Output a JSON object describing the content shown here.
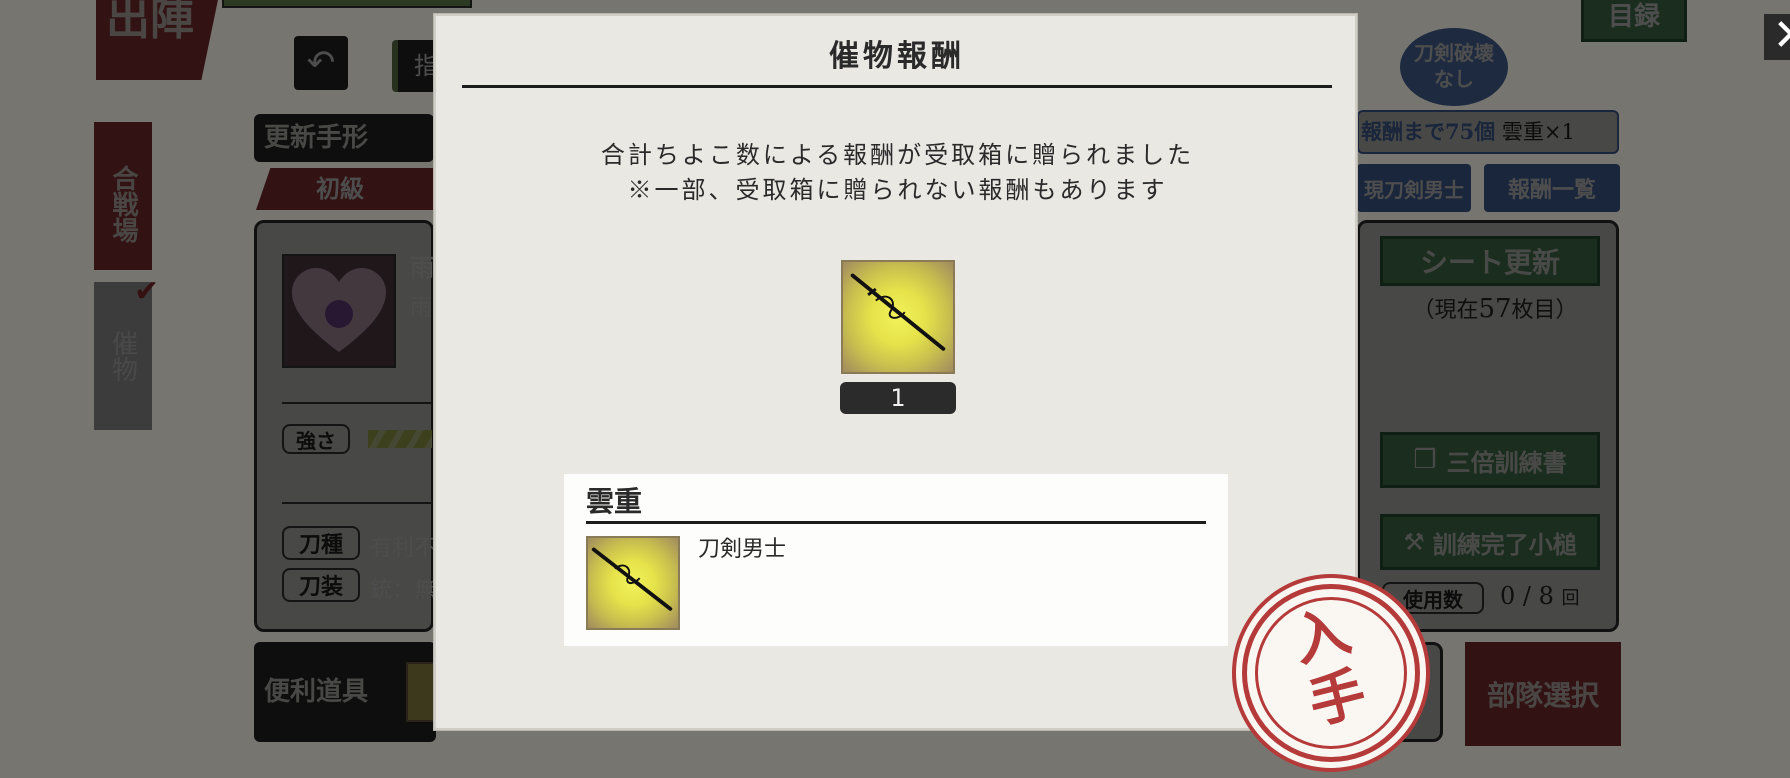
{
  "background": {
    "top_left_banner": "出陣",
    "sidebar_tab_active": "合戦場",
    "sidebar_tab_inactive": "催物",
    "bar_label": "更新手形",
    "level_tab": "初級",
    "partial_tab": "指",
    "char_name_partial": "雨",
    "char_sub_partial": "雨",
    "strength_label": "強さ",
    "blade_type_label": "刀種",
    "blade_type_value": "有利不",
    "equip_label": "刀装",
    "equip_value": "銃：無",
    "tools_label": "便利道具",
    "top_right_button": "目録",
    "no_break_badge": "刀剣破壊なし",
    "reward_progress": "報酬まで75個",
    "reward_preview": "雲重×1",
    "current_swords_tab": "現刀剣男士",
    "reward_list_button": "報酬一覧",
    "sheet_update_button": "シート更新",
    "sheet_current": "（現在",
    "sheet_number": "57",
    "sheet_suffix": "枚目）",
    "triple_book_button": "三倍訓練書",
    "training_hammer_button": "訓練完了小槌",
    "usage_label": "使用数",
    "usage_value": "0 / 8",
    "usage_unit": "回",
    "team_select_button": "部隊選択"
  },
  "modal": {
    "title": "催物報酬",
    "message_line1": "合計ちよこ数による報酬が受取箱に贈られました",
    "message_line2": "※一部、受取箱に贈られない報酬もあります",
    "reward_count": "1",
    "item_name": "雲重",
    "item_type": "刀剣男士",
    "close_symbol": "✕",
    "stamp_text": "入手"
  },
  "colors": {
    "accent_red": "#b53a3a",
    "accent_green": "#4f9a5d",
    "accent_blue": "#4d7ed1",
    "modal_bg": "#e9e8e3"
  }
}
